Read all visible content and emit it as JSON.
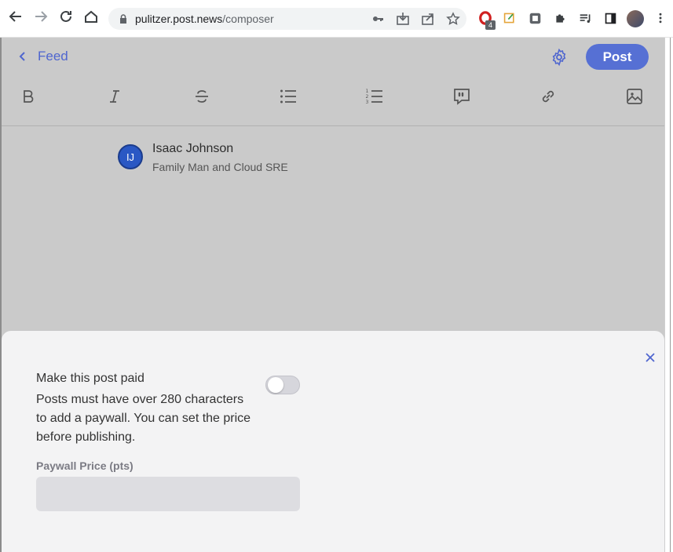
{
  "browser": {
    "url_host": "pulitzer.post.news",
    "url_path": "/composer",
    "extension_badge": "4"
  },
  "header": {
    "back_label": "Feed",
    "post_label": "Post"
  },
  "formatting": [
    "bold-icon",
    "italic-icon",
    "strikethrough-icon",
    "bullet-list-icon",
    "numbered-list-icon",
    "quote-icon",
    "link-icon",
    "image-icon"
  ],
  "author": {
    "initials": "IJ",
    "name": "Isaac Johnson",
    "bio": "Family Man and Cloud SRE"
  },
  "sheet": {
    "paid_title": "Make this post paid",
    "paid_description": "Posts must have over 280 characters to add a paywall. You can set the price before publishing.",
    "toggle_on": false,
    "price_label": "Paywall Price (pts)",
    "price_value": ""
  },
  "colors": {
    "accent": "#5670d4",
    "overlay": "#cacaca",
    "sheet": "#f3f3f4"
  }
}
